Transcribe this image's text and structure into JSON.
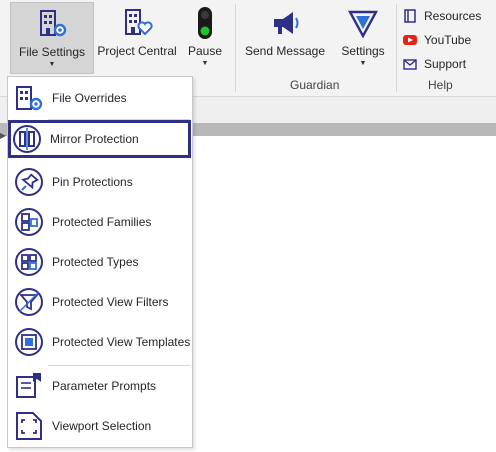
{
  "ribbon": {
    "file_settings": "File Settings",
    "project_central": "Project Central",
    "pause": "Pause",
    "send_message": "Send Message",
    "settings": "Settings",
    "guardian_group": "Guardian",
    "resources": "Resources",
    "youtube": "YouTube",
    "support": "Support",
    "help_group": "Help"
  },
  "menu": {
    "items": [
      {
        "label": "File Overrides",
        "icon": "file-overrides-icon"
      },
      {
        "label": "Mirror Protection",
        "icon": "mirror-protection-icon",
        "selected": true
      },
      {
        "label": "Pin Protections",
        "icon": "pin-icon"
      },
      {
        "label": "Protected Families",
        "icon": "families-icon"
      },
      {
        "label": "Protected Types",
        "icon": "types-icon"
      },
      {
        "label": "Protected View Filters",
        "icon": "filter-icon"
      },
      {
        "label": "Protected View Templates",
        "icon": "template-icon"
      },
      {
        "label": "Parameter Prompts",
        "icon": "parameter-icon"
      },
      {
        "label": "Viewport Selection",
        "icon": "viewport-icon"
      }
    ]
  },
  "colors": {
    "icon_navy": "#2e2f86",
    "accent_blue": "#2f6fd6",
    "highlight_border": "#2e2f86",
    "youtube_red": "#e62117",
    "traffic_green": "#1fc52b"
  }
}
